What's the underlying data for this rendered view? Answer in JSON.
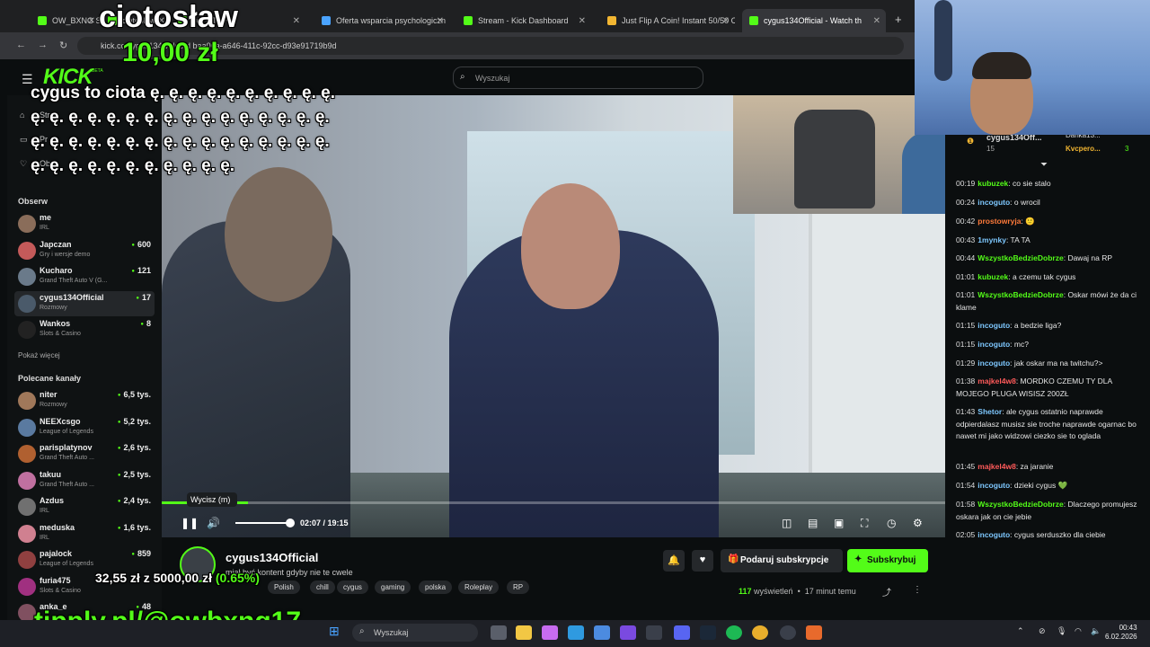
{
  "browser": {
    "tabs": [
      {
        "title": "OW_BXNG Stre",
        "fav": "#53fc18"
      },
      {
        "title": "ciotosław",
        "fav": "#53fc18"
      },
      {
        "title": "ver GTA RP",
        "fav": "#53fc18"
      },
      {
        "title": "Oferta wsparcia psychologiczn",
        "fav": "#4aa3ff"
      },
      {
        "title": "Stream - Kick Dashboard",
        "fav": "#53fc18"
      },
      {
        "title": "Just Flip A Coin! Instant 50/50 C",
        "fav": "#f2b632"
      },
      {
        "title": "cygus134Official - Watch th",
        "fav": "#53fc18"
      }
    ],
    "url": "kick.co   cygus134 video   d   baa06a-a646-411c-92cc-d93e91719b9d"
  },
  "header": {
    "logo": "KICK",
    "logo_beta": "BETA",
    "search_placeholder": "Wyszukaj"
  },
  "sidebar": {
    "nav": [
      "Str",
      "Pr",
      "Obs"
    ],
    "following_title": "Obserw",
    "following": [
      {
        "name": "me",
        "sub": "IRL",
        "viewers": "",
        "color": "#8a6d5a"
      },
      {
        "name": "Japczan",
        "sub": "Gry i wersje demo",
        "viewers": "600",
        "color": "#c45a5a"
      },
      {
        "name": "Kucharo",
        "sub": "Grand Theft Auto V (G...",
        "viewers": "121",
        "color": "#6a7a8a"
      },
      {
        "name": "cygus134Official",
        "sub": "Rozmowy",
        "viewers": "17",
        "color": "#4a5a6a"
      },
      {
        "name": "Wankos",
        "sub": "Slots & Casino",
        "viewers": "8",
        "color": "#222"
      }
    ],
    "show_more": "Pokaż więcej",
    "recommended_title": "Polecane kanały",
    "recommended": [
      {
        "name": "niter",
        "sub": "Rozmowy",
        "viewers": "6,5 tys.",
        "color": "#a0785a"
      },
      {
        "name": "NEEXcsgo",
        "sub": "League of Legends",
        "viewers": "5,2 tys.",
        "color": "#5a7aa0"
      },
      {
        "name": "parisplatynov",
        "sub": "Grand Theft Auto ...",
        "viewers": "2,6 tys.",
        "color": "#b06030"
      },
      {
        "name": "takuu",
        "sub": "Grand Theft Auto ...",
        "viewers": "2,5 tys.",
        "color": "#c070a0"
      },
      {
        "name": "Azdus",
        "sub": "IRL",
        "viewers": "2,4 tys.",
        "color": "#707070"
      },
      {
        "name": "meduska",
        "sub": "IRL",
        "viewers": "1,6 tys.",
        "color": "#d08090"
      },
      {
        "name": "pajalock",
        "sub": "League of Legends",
        "viewers": "859",
        "color": "#904040"
      },
      {
        "name": "furia475",
        "sub": "Slots & Casino",
        "viewers": "",
        "color": "#a03080"
      },
      {
        "name": "anka_e",
        "sub": "",
        "viewers": "48",
        "color": "#805060"
      }
    ]
  },
  "player": {
    "tooltip": "Wycisz (m)",
    "time": "02:07 / 19:15",
    "progress": 0.11,
    "volume": 0.95
  },
  "channel": {
    "name": "cygus134Official",
    "title": "miał być kontent gdyby nie te cwele",
    "tags": [
      "Polish",
      "chill",
      "cygus",
      "gaming",
      "polska",
      "Roleplay",
      "RP"
    ],
    "bell": "🔔",
    "heart": "♥",
    "gift_label": "Podaruj subskrypcje",
    "subscribe_label": "Subskrybuj",
    "views_count": "117",
    "views_label": "wyświetleń",
    "time_ago": "17 minut temu"
  },
  "chat": {
    "pinned_user": "cygus134Off...",
    "pinned_count": "15",
    "pinned_right": "Kvcpero...",
    "pinned_right_count": "3",
    "pinned_top": "Danka13...",
    "messages": [
      {
        "ts": "00:19",
        "user": "kubuzek",
        "color": "#53fc18",
        "text": "co sie stalo"
      },
      {
        "ts": "00:24",
        "user": "incoguto",
        "color": "#7ec8ff",
        "text": "o wrocil"
      },
      {
        "ts": "00:42",
        "user": "prostowryja",
        "color": "#ff7a3a",
        "text": "🙂"
      },
      {
        "ts": "00:43",
        "user": "1mynky",
        "color": "#7ec8ff",
        "text": "TA TA"
      },
      {
        "ts": "00:44",
        "user": "WszystkoBedzieDobrze",
        "color": "#53fc18",
        "text": "Dawaj na RP"
      },
      {
        "ts": "01:01",
        "user": "kubuzek",
        "color": "#53fc18",
        "text": "a czemu tak cygus"
      },
      {
        "ts": "01:01",
        "user": "WszystkoBedzieDobrze",
        "color": "#53fc18",
        "text": "Oskar mówi że da ci klame"
      },
      {
        "ts": "01:15",
        "user": "incoguto",
        "color": "#7ec8ff",
        "text": "a bedzie liga?"
      },
      {
        "ts": "01:15",
        "user": "incoguto",
        "color": "#7ec8ff",
        "text": "mc?"
      },
      {
        "ts": "01:29",
        "user": "incoguto",
        "color": "#7ec8ff",
        "text": "jak oskar ma na twitchu?>"
      },
      {
        "ts": "01:38",
        "user": "majkel4w8",
        "color": "#ff5a5a",
        "text": "MORDKO CZEMU TY DLA MOJEGO PLUGA WISISZ 200ZŁ"
      },
      {
        "ts": "01:43",
        "user": "Shetor",
        "color": "#7ec8ff",
        "text": "ale cygus ostatnio naprawde odpierdalasz musisz sie troche naprawde ogarnac bo nawet mi jako widzowi ciezko sie to oglada"
      },
      {
        "ts": "01:45",
        "user": "majkel4w8",
        "color": "#ff5a5a",
        "text": "za jaranie"
      },
      {
        "ts": "01:54",
        "user": "incoguto",
        "color": "#7ec8ff",
        "text": "dzieki cygus 💚"
      },
      {
        "ts": "01:58",
        "user": "WszystkoBedzieDobrze",
        "color": "#53fc18",
        "text": "Dlaczego promujesz oskara jak on cie jebie"
      },
      {
        "ts": "02:05",
        "user": "incoguto",
        "color": "#7ec8ff",
        "text": "cygus serduszko dla ciebie"
      }
    ]
  },
  "overlay": {
    "donor": "ciotosław",
    "amount": "10,00 zł",
    "message": "cygus to ciota ę. ę. ę. ę. ę. ę. ę. ę. ę. ę. ę. ę. ę. ę. ę. ę. ę. ę. ę. ę. ę. ę. ę. ę. ę. ę. ę. ę. ę. ę. ę. ę. ę. ę. ę. ę. ę. ę. ę. ę. ę. ę. ę. ę. ę. ę. ę. ę. ę. ę. ę. ę. ę.",
    "goal_current": "32,55 zł",
    "goal_sep": "z",
    "goal_total": "5000,00 zł",
    "goal_pct": "(0.65%)",
    "tipply": "tipply.pl/@owbxng17"
  },
  "taskbar": {
    "search": "Wyszukaj",
    "time": "00:43",
    "date": "6.02.2026"
  }
}
